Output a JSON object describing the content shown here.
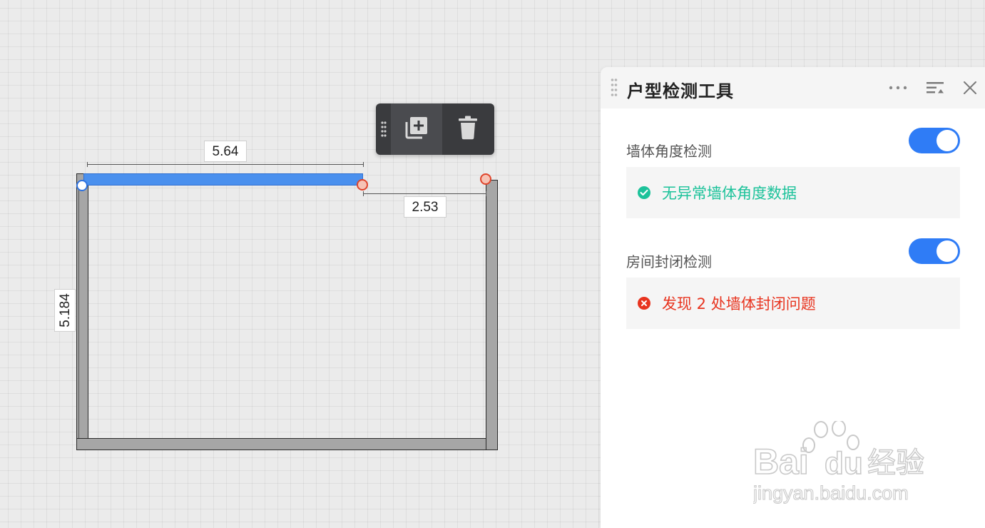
{
  "canvas": {
    "dimensions": {
      "top": "5.64",
      "right": "2.53",
      "left": "5.184"
    }
  },
  "toolbar": {
    "buttons": [
      {
        "icon": "copy-add-icon"
      },
      {
        "icon": "trash-icon"
      }
    ]
  },
  "panel": {
    "title": "户型检测工具",
    "header_icons": [
      "more-icon",
      "collapse-icon",
      "close-icon"
    ],
    "sections": [
      {
        "title": "墙体角度检测",
        "enabled": true,
        "result": {
          "status": "ok",
          "text": "无异常墙体角度数据",
          "color": "#1cc29a"
        }
      },
      {
        "title": "房间封闭检测",
        "enabled": true,
        "result": {
          "status": "error",
          "text": "发现 2 处墙体封闭问题",
          "color": "#e8341f"
        }
      }
    ]
  },
  "colors": {
    "accent": "#2f7cf6",
    "selected_wall": "#4a90ee",
    "wall": "#a6a6a6"
  },
  "watermark": {
    "brand": "Bai du 经验",
    "url": "jingyan.baidu.com"
  }
}
